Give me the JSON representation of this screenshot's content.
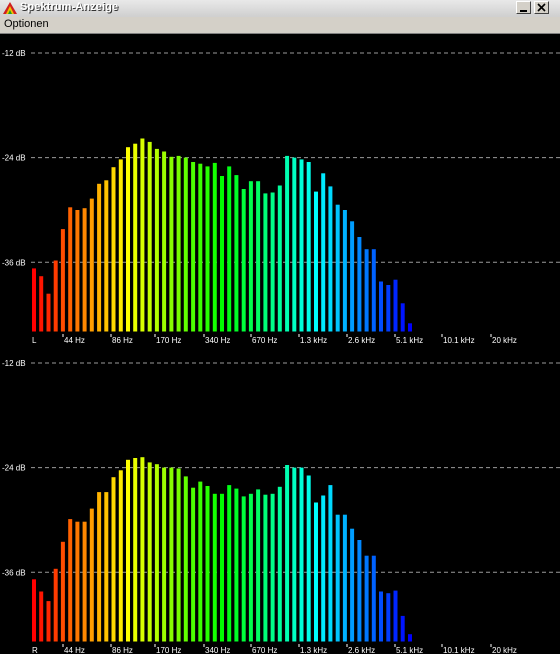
{
  "window": {
    "title": "Spektrum-Anzeige"
  },
  "menu": {
    "items": [
      "Optionen"
    ]
  },
  "chart_data": [
    {
      "type": "bar",
      "channel": "L",
      "db_labels": [
        "-12 dB",
        "-24 dB",
        "-36 dB"
      ],
      "freq_labels": [
        "44 Hz",
        "86 Hz",
        "170 Hz",
        "340 Hz",
        "670 Hz",
        "1.3 kHz",
        "2.6 kHz",
        "5.1 kHz",
        "10.1 kHz",
        "20 kHz"
      ],
      "ylim": [
        -44,
        -10
      ],
      "values": [
        -36.7,
        -37.6,
        -39.6,
        -35.8,
        -32.2,
        -29.7,
        -30.0,
        -29.8,
        -28.7,
        -27.0,
        -26.6,
        -25.1,
        -24.2,
        -22.8,
        -22.4,
        -21.8,
        -22.2,
        -23.0,
        -23.3,
        -23.9,
        -23.8,
        -24.0,
        -24.5,
        -24.7,
        -25.0,
        -24.6,
        -26.1,
        -25.0,
        -26.0,
        -27.6,
        -26.7,
        -26.7,
        -28.1,
        -28.0,
        -27.2,
        -23.8,
        -24.0,
        -24.2,
        -24.5,
        -27.9,
        -25.8,
        -27.3,
        -29.4,
        -30.0,
        -31.3,
        -33.1,
        -34.5,
        -34.5,
        -38.2,
        -38.6,
        -38.0,
        -40.7,
        -43.0
      ]
    },
    {
      "type": "bar",
      "channel": "R",
      "db_labels": [
        "-12 dB",
        "-24 dB",
        "-36 dB"
      ],
      "freq_labels": [
        "44 Hz",
        "86 Hz",
        "170 Hz",
        "340 Hz",
        "670 Hz",
        "1.3 kHz",
        "2.6 kHz",
        "5.1 kHz",
        "10.1 kHz",
        "20 kHz"
      ],
      "ylim": [
        -44,
        -10
      ],
      "values": [
        -36.8,
        -38.2,
        -39.3,
        -35.6,
        -32.5,
        -29.9,
        -30.2,
        -30.2,
        -28.7,
        -26.8,
        -26.8,
        -25.1,
        -24.3,
        -23.1,
        -22.9,
        -22.8,
        -23.4,
        -23.6,
        -24.0,
        -24.0,
        -24.1,
        -25.0,
        -26.3,
        -25.6,
        -26.1,
        -27.0,
        -27.0,
        -26.0,
        -26.4,
        -27.3,
        -27.0,
        -26.5,
        -27.1,
        -27.0,
        -26.2,
        -23.7,
        -24.0,
        -24.0,
        -24.9,
        -28.0,
        -27.2,
        -26.0,
        -29.4,
        -29.4,
        -31.0,
        -32.3,
        -34.1,
        -34.1,
        -38.2,
        -38.4,
        -38.1,
        -41.0,
        -43.1
      ]
    }
  ]
}
